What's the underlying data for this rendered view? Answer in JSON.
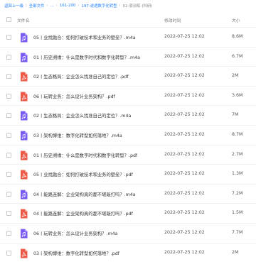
{
  "breadcrumb": {
    "back": "返回上一级",
    "items": [
      "全部文件",
      "...",
      "161-200",
      "197-说透数字化转型",
      "02-原训练 (科研)"
    ]
  },
  "header": {
    "name": "文件名",
    "time": "修改时间",
    "size": "大小"
  },
  "files": [
    {
      "icon": "audio-file-icon",
      "name": "05丨业找融合：如何打破技术和业务的壁垒？.m4a",
      "time": "2022-07-25 12:02",
      "size": "8.6M"
    },
    {
      "icon": "audio-file-icon",
      "name": "01丨历史溯缘：什么是数字时代和数字化转型？.m4a",
      "time": "2022-07-25 12:02",
      "size": "6.7M"
    },
    {
      "icon": "pdf-file-icon",
      "name": "02丨生态格局：企业怎么找准自己的定位？.pdf",
      "time": "2022-07-25 12:02",
      "size": "2M"
    },
    {
      "icon": "pdf-file-icon",
      "name": "06丨玩转业务：怎么设计业务架构？.pdf",
      "time": "2022-07-25 12:02",
      "size": "3.6M"
    },
    {
      "icon": "audio-file-icon",
      "name": "02丨生态格局：企业怎么找准自己的定位？.m4a",
      "time": "2022-07-25 12:02",
      "size": "7M"
    },
    {
      "icon": "audio-file-icon",
      "name": "03丨架构博维：数字化转型如何落地？.m4a",
      "time": "2022-07-25 12:02",
      "size": "8.7M"
    },
    {
      "icon": "pdf-file-icon",
      "name": "01丨历史溯缘：什么是数字时代和数字化转型？.pdf",
      "time": "2022-07-25 12:02",
      "size": "2.7M"
    },
    {
      "icon": "pdf-file-icon",
      "name": "05丨业找融合：如何打破技术和业务的壁垒？.pdf",
      "time": "2022-07-25 12:02",
      "size": "1.3M"
    },
    {
      "icon": "audio-file-icon",
      "name": "04丨能路连解：企业架构真的都不堪敲打吗？.m4a",
      "time": "2022-07-25 12:02",
      "size": "7.2M"
    },
    {
      "icon": "pdf-file-icon",
      "name": "04丨能路连解：企业架构真的都不堪敲打吗？.pdf",
      "time": "2022-07-25 12:02",
      "size": "1.5M"
    },
    {
      "icon": "audio-file-icon",
      "name": "06丨玩转业务：怎么设计业务架构？.m4a",
      "time": "2022-07-25 12:02",
      "size": "7.7M"
    },
    {
      "icon": "pdf-file-icon",
      "name": "03丨架构博维：数字化转型如何落地？.pdf",
      "time": "2022-07-25 12:02",
      "size": "2M"
    }
  ],
  "colors": {
    "link": "#1f7fff",
    "audio": "#7b5cf3",
    "pdf": "#ef5a48"
  }
}
